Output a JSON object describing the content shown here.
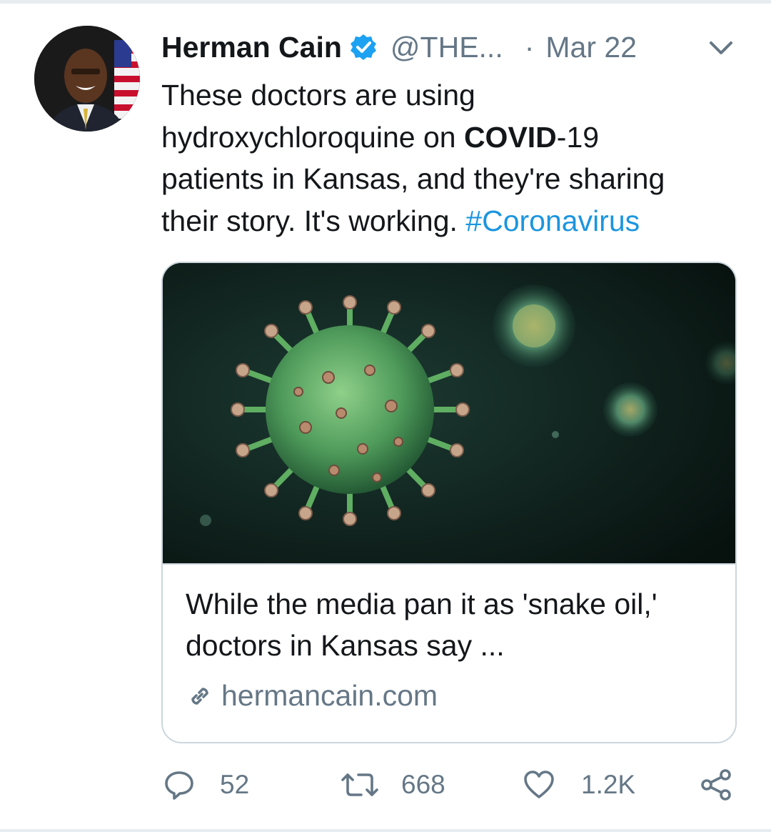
{
  "tweet": {
    "author_name": "Herman Cain",
    "handle": "@THE...",
    "separator": "·",
    "date": "Mar 22",
    "text_line1": "These doctors are using",
    "text_line2a": "hydroxychloroquine on ",
    "text_line2_bold": "COVID",
    "text_line2b": "-19",
    "text_line3": "patients in Kansas, and they're sharing",
    "text_line4": "their story. It's working. ",
    "hashtag": "#Coronavirus"
  },
  "card": {
    "title_line1": "While the media pan it as 'snake oil,'",
    "title_line2": "doctors in Kansas say ...",
    "domain": "hermancain.com",
    "image_subject": "coronavirus-illustration"
  },
  "actions": {
    "replies": "52",
    "retweets": "668",
    "likes": "1.2K"
  },
  "colors": {
    "text": "#14171a",
    "secondary": "#657786",
    "link": "#1b95e0",
    "verified": "#1da1f2",
    "border": "#ccd6dd"
  },
  "icons": [
    "verified-badge-icon",
    "chevron-down-icon",
    "link-icon",
    "reply-icon",
    "retweet-icon",
    "like-icon",
    "share-icon"
  ]
}
